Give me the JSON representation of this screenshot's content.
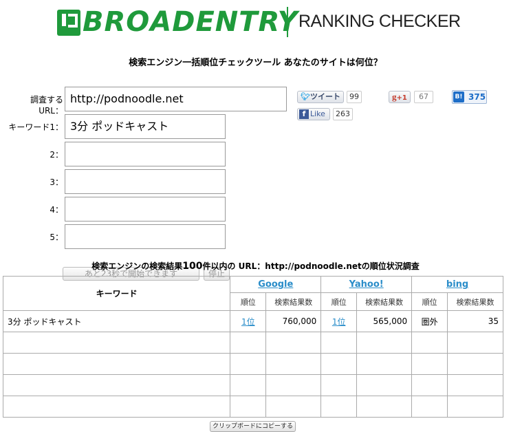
{
  "header": {
    "brand": "BROADENTRY",
    "product": "RANKING CHECKER",
    "tagline": "検索エンジン一括順位チェックツール あなたのサイトは何位？"
  },
  "form": {
    "url_label": "調査するURL：",
    "url_value": "http://podnoodle.net",
    "keyword_labels": [
      "キーワード1：",
      "2：",
      "3：",
      "4：",
      "5："
    ],
    "keyword_values": [
      "3分 ポッドキャスト",
      "",
      "",
      "",
      ""
    ],
    "start_button": "あと23秒で開始できます",
    "stop_button": "停止",
    "notice_prefix": "検索エンジンの検索結果",
    "notice_number": "100",
    "notice_mid": "件以内の URL：",
    "notice_url": "http://podnoodle.net",
    "notice_suffix": "の順位状況調査"
  },
  "social": {
    "tweet_label": "ツイート",
    "tweet_count": "99",
    "gplus_label": "+1",
    "gplus_count": "67",
    "hatena_label": "B!",
    "hatena_count": "375",
    "fb_label": "Like",
    "fb_count": "263"
  },
  "table": {
    "keyword_header": "キーワード",
    "engines": [
      "Google",
      "Yahoo!",
      "bing"
    ],
    "rank_header": "順位",
    "count_header": "検索結果数",
    "rows": [
      {
        "keyword": "3分 ポッドキャスト",
        "google_rank": "1位",
        "google_count": "760,000",
        "yahoo_rank": "1位",
        "yahoo_count": "565,000",
        "bing_rank": "圏外",
        "bing_count": "35"
      }
    ]
  },
  "copy_button": "クリップボードにコピーする",
  "colors": {
    "brand_green": "#1f9a3b",
    "link_blue": "#2a8dc9"
  }
}
